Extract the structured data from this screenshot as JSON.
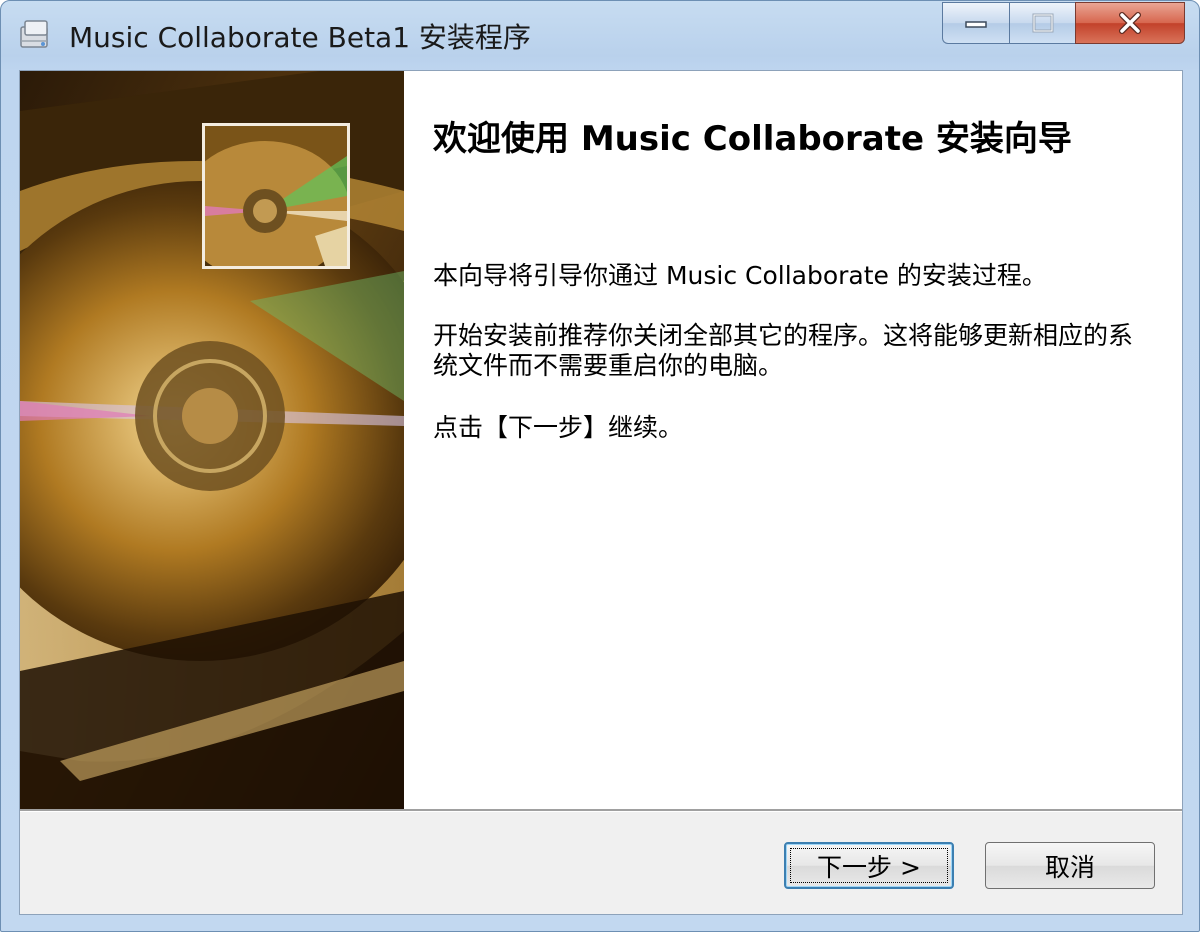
{
  "window": {
    "title": "Music Collaborate Beta1 安装程序"
  },
  "caption_buttons": {
    "minimize": "minimize-icon",
    "maximize": "maximize-icon",
    "close": "close-icon"
  },
  "content": {
    "heading": "欢迎使用 Music Collaborate 安装向导",
    "paragraph1": "本向导将引导你通过 Music Collaborate 的安装过程。",
    "paragraph2": "开始安装前推荐你关闭全部其它的程序。这将能够更新相应的系统文件而不需要重启你的电脑。",
    "paragraph3": "点击【下一步】继续。"
  },
  "buttons": {
    "next": "下一步 >",
    "cancel": "取消"
  },
  "colors": {
    "close_button": "#c94a30",
    "focus_border": "#3c7fb1"
  }
}
